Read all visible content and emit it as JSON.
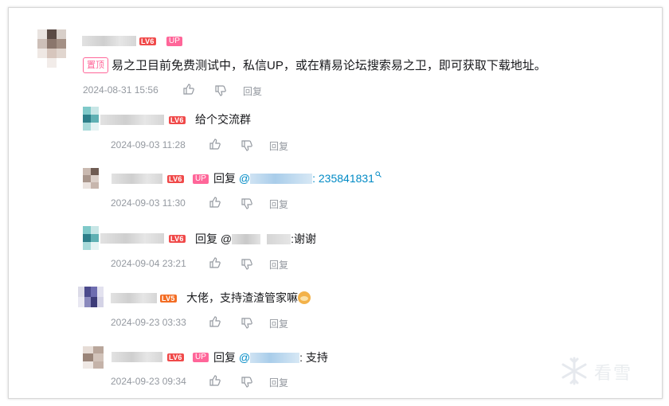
{
  "comments": [
    {
      "badges": {
        "level": "LV6",
        "up": "UP"
      },
      "pinned": "置顶",
      "text": "易之卫目前免费测试中，私信UP，或在精易论坛搜索易之卫，即可获取下载地址。",
      "time": "2024-08-31 15:56",
      "reply_label": "回复"
    }
  ],
  "replies": [
    {
      "level": "LV6",
      "text": "给个交流群",
      "time": "2024-09-03 11:28",
      "reply_label": "回复"
    },
    {
      "level": "LV6",
      "up": "UP",
      "prefix": "回复 ",
      "mention_at": "@",
      "mention_tail": ": ",
      "link": "235841831",
      "time": "2024-09-03 11:30",
      "reply_label": "回复"
    },
    {
      "level": "LV6",
      "prefix": "回复 @",
      "tail": ":谢谢",
      "time": "2024-09-04 23:21",
      "reply_label": "回复"
    },
    {
      "level": "LV5",
      "text": "大佬，支持渣渣管家嘛",
      "time": "2024-09-23 03:33",
      "reply_label": "回复"
    },
    {
      "level": "LV6",
      "up": "UP",
      "prefix": "回复 ",
      "mention_at": "@",
      "tail": ": 支持",
      "time": "2024-09-23 09:34",
      "reply_label": "回复"
    }
  ],
  "watermark": "看雪",
  "colors": {
    "up_badge": "#ff6699",
    "level6": "#f04a4a",
    "level5": "#f36d24",
    "link": "#008ac5",
    "meta": "#9499a0"
  }
}
